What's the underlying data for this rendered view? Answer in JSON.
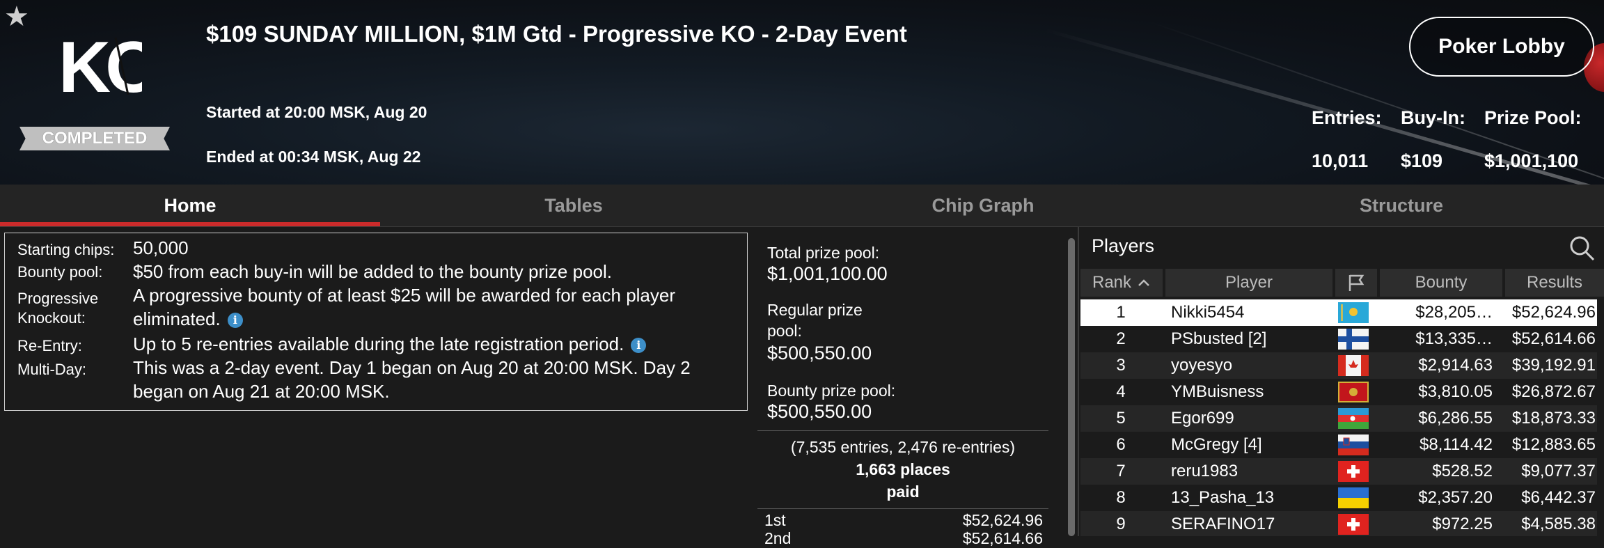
{
  "header": {
    "logo_text": "KO",
    "status": "COMPLETED",
    "title": "$109 SUNDAY MILLION, $1M Gtd - Progressive KO - 2-Day Event",
    "started": "Started at 20:00 MSK, Aug 20",
    "ended": "Ended at 00:34 MSK, Aug 22",
    "lobby_button": "Poker Lobby",
    "stats": {
      "entries_label": "Entries:",
      "entries_value": "10,011",
      "buyin_label": "Buy-In:",
      "buyin_value": "$109",
      "prizepool_label": "Prize Pool:",
      "prizepool_value": "$1,001,100"
    }
  },
  "tabs": [
    {
      "label": "Home",
      "active": true
    },
    {
      "label": "Tables",
      "active": false
    },
    {
      "label": "Chip Graph",
      "active": false
    },
    {
      "label": "Structure",
      "active": false
    }
  ],
  "info": {
    "starting_chips_label": "Starting chips:",
    "starting_chips_value": "50,000",
    "bounty_pool_label": "Bounty pool:",
    "bounty_pool_value": "$50 from each buy-in will be added to the bounty prize pool.",
    "progressive_label_1": "Progressive",
    "progressive_label_2": "Knockout:",
    "progressive_value_1": "A progressive bounty of at least $25 will be awarded for each player",
    "progressive_value_2": "eliminated.",
    "reentry_label": "Re-Entry:",
    "reentry_value": "Up to 5 re-entries available during the late registration period.",
    "multiday_label": "Multi-Day:",
    "multiday_value_1": "This was a 2-day event. Day 1 began on Aug 20 at 20:00 MSK. Day 2",
    "multiday_value_2": "began on Aug 21 at 20:00 MSK.",
    "info_icon_glyph": "i"
  },
  "prizes": {
    "total_label": "Total prize pool:",
    "total_value": "$1,001,100.00",
    "regular_label_1": "Regular prize",
    "regular_label_2": "pool:",
    "regular_value": "$500,550.00",
    "bounty_label": "Bounty prize pool:",
    "bounty_value": "$500,550.00",
    "entries_summary": "(7,535 entries, 2,476 re-entries)",
    "places_paid_1": "1,663 places",
    "places_paid_2": "paid",
    "places": [
      {
        "place": "1st",
        "amount": "$52,624.96"
      },
      {
        "place": "2nd",
        "amount": "$52,614.66"
      }
    ]
  },
  "players": {
    "title": "Players",
    "columns": {
      "rank": "Rank",
      "player": "Player",
      "bounty": "Bounty",
      "results": "Results"
    },
    "rows": [
      {
        "rank": "1",
        "name": "Nikki5454",
        "flag": "kazakhstan-flag",
        "bounty": "$28,205…",
        "result": "$52,624.96"
      },
      {
        "rank": "2",
        "name": "PSbusted [2]",
        "flag": "finland-flag",
        "bounty": "$13,335…",
        "result": "$52,614.66"
      },
      {
        "rank": "3",
        "name": "yoyesyo",
        "flag": "canada-flag",
        "bounty": "$2,914.63",
        "result": "$39,192.91"
      },
      {
        "rank": "4",
        "name": "YMBuisness",
        "flag": "montenegro-flag",
        "bounty": "$3,810.05",
        "result": "$26,872.67"
      },
      {
        "rank": "5",
        "name": "Egor699",
        "flag": "azerbaijan-flag",
        "bounty": "$6,286.55",
        "result": "$18,873.33"
      },
      {
        "rank": "6",
        "name": "McGregy [4]",
        "flag": "slovenia-flag",
        "bounty": "$8,114.42",
        "result": "$12,883.65"
      },
      {
        "rank": "7",
        "name": "reru1983",
        "flag": "switzerland-flag",
        "bounty": "$528.52",
        "result": "$9,077.37"
      },
      {
        "rank": "8",
        "name": "13_Pasha_13",
        "flag": "ukraine-flag",
        "bounty": "$2,357.20",
        "result": "$6,442.37"
      },
      {
        "rank": "9",
        "name": "SERAFINO17",
        "flag": "switzerland-flag",
        "bounty": "$972.25",
        "result": "$4,585.38"
      }
    ]
  },
  "colors": {
    "tab_active_underline": "#cc2b2b",
    "info_icon": "#3d8fc9",
    "selected_row": "#ffffff"
  }
}
